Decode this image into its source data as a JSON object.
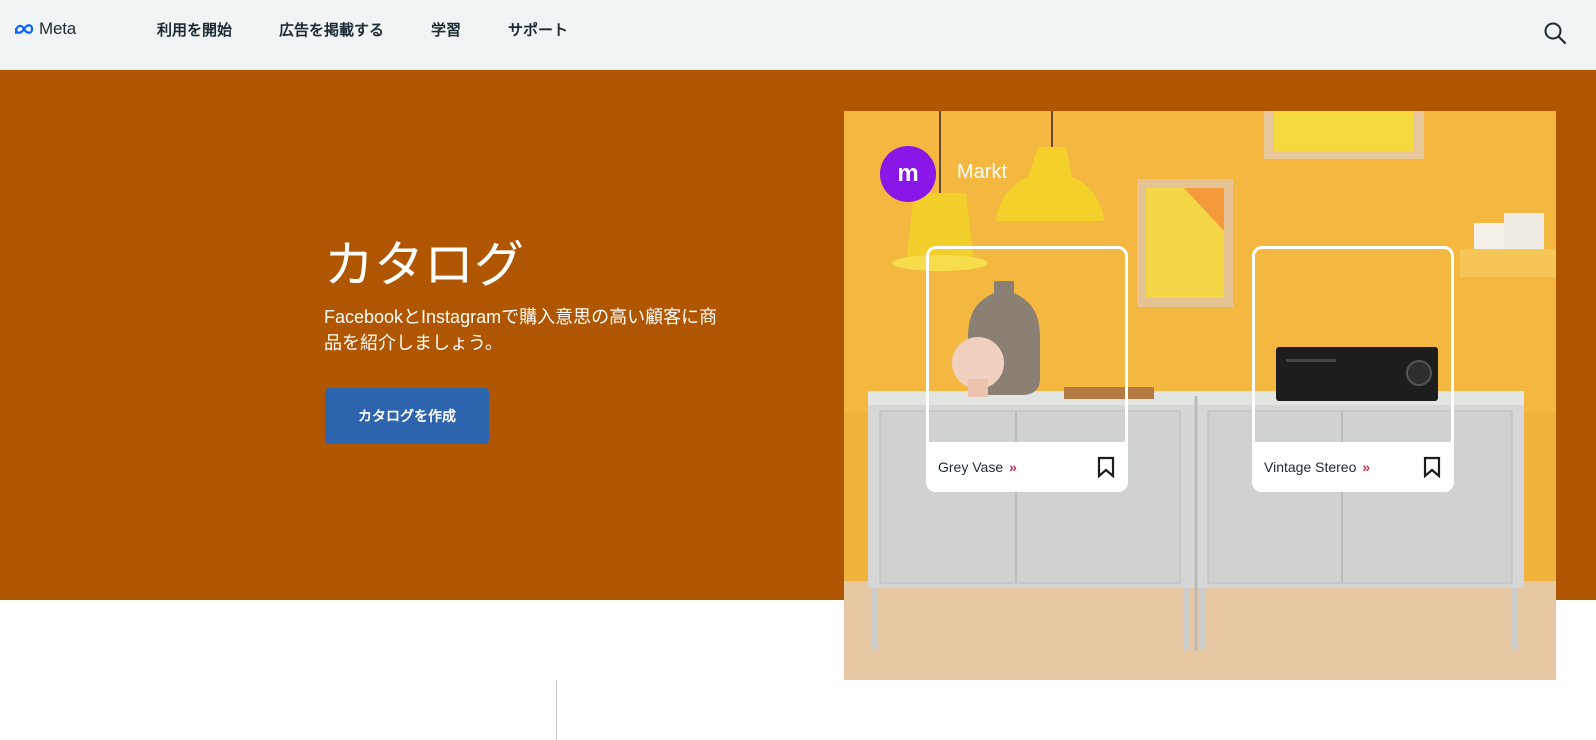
{
  "nav": {
    "logo_text": "Meta",
    "items": [
      {
        "label": "利用を開始"
      },
      {
        "label": "広告を掲載する"
      },
      {
        "label": "学習"
      },
      {
        "label": "サポート"
      }
    ],
    "search_icon": "search-icon"
  },
  "hero": {
    "title": "カタログ",
    "description": "FacebookとInstagramで購入意思の高い顧客に商品を紹介しましょう。",
    "cta_label": "カタログを作成",
    "background_color": "#b05500",
    "cta_color": "#2d64ae"
  },
  "showcase": {
    "brand_initial": "m",
    "brand_name": "Markt",
    "products": [
      {
        "name": "Grey Vase"
      },
      {
        "name": "Vintage Stereo"
      }
    ]
  }
}
